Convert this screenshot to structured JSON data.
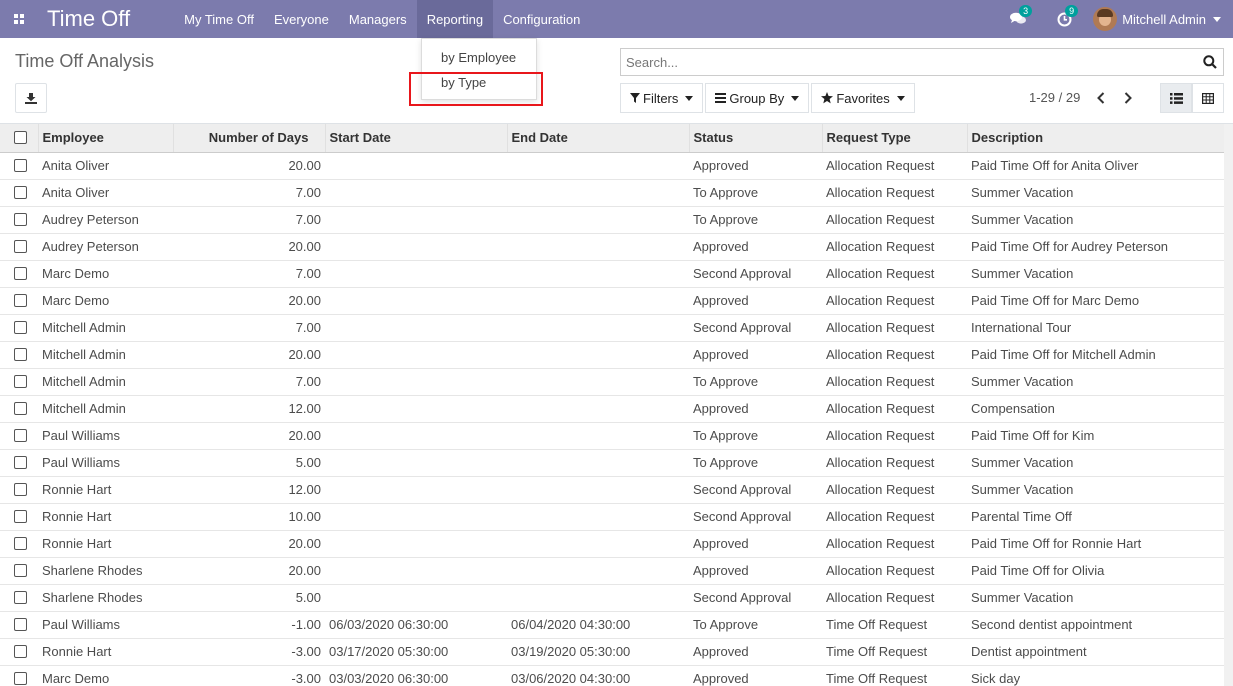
{
  "nav": {
    "brand": "Time Off",
    "menu": [
      "My Time Off",
      "Everyone",
      "Managers",
      "Reporting",
      "Configuration"
    ],
    "active_menu": "Reporting",
    "messages_count": "3",
    "activities_count": "9",
    "user_name": "Mitchell Admin"
  },
  "reporting_menu": {
    "items": [
      "by Employee",
      "by Type"
    ],
    "highlighted": "by Type"
  },
  "control_panel": {
    "title": "Time Off Analysis",
    "search_placeholder": "Search...",
    "filters_label": "Filters",
    "groupby_label": "Group By",
    "favorites_label": "Favorites",
    "pager": "1-29 / 29"
  },
  "table": {
    "columns": [
      "Employee",
      "Number of Days",
      "Start Date",
      "End Date",
      "Status",
      "Request Type",
      "Description"
    ],
    "rows": [
      [
        "Anita Oliver",
        "20.00",
        "",
        "",
        "Approved",
        "Allocation Request",
        "Paid Time Off for Anita Oliver"
      ],
      [
        "Anita Oliver",
        "7.00",
        "",
        "",
        "To Approve",
        "Allocation Request",
        "Summer Vacation"
      ],
      [
        "Audrey Peterson",
        "7.00",
        "",
        "",
        "To Approve",
        "Allocation Request",
        "Summer Vacation"
      ],
      [
        "Audrey Peterson",
        "20.00",
        "",
        "",
        "Approved",
        "Allocation Request",
        "Paid Time Off for Audrey Peterson"
      ],
      [
        "Marc Demo",
        "7.00",
        "",
        "",
        "Second Approval",
        "Allocation Request",
        "Summer Vacation"
      ],
      [
        "Marc Demo",
        "20.00",
        "",
        "",
        "Approved",
        "Allocation Request",
        "Paid Time Off for Marc Demo"
      ],
      [
        "Mitchell Admin",
        "7.00",
        "",
        "",
        "Second Approval",
        "Allocation Request",
        "International Tour"
      ],
      [
        "Mitchell Admin",
        "20.00",
        "",
        "",
        "Approved",
        "Allocation Request",
        "Paid Time Off for Mitchell Admin"
      ],
      [
        "Mitchell Admin",
        "7.00",
        "",
        "",
        "To Approve",
        "Allocation Request",
        "Summer Vacation"
      ],
      [
        "Mitchell Admin",
        "12.00",
        "",
        "",
        "Approved",
        "Allocation Request",
        "Compensation"
      ],
      [
        "Paul Williams",
        "20.00",
        "",
        "",
        "To Approve",
        "Allocation Request",
        "Paid Time Off for Kim"
      ],
      [
        "Paul Williams",
        "5.00",
        "",
        "",
        "To Approve",
        "Allocation Request",
        "Summer Vacation"
      ],
      [
        "Ronnie Hart",
        "12.00",
        "",
        "",
        "Second Approval",
        "Allocation Request",
        "Summer Vacation"
      ],
      [
        "Ronnie Hart",
        "10.00",
        "",
        "",
        "Second Approval",
        "Allocation Request",
        "Parental Time Off"
      ],
      [
        "Ronnie Hart",
        "20.00",
        "",
        "",
        "Approved",
        "Allocation Request",
        "Paid Time Off for Ronnie Hart"
      ],
      [
        "Sharlene Rhodes",
        "20.00",
        "",
        "",
        "Approved",
        "Allocation Request",
        "Paid Time Off for Olivia"
      ],
      [
        "Sharlene Rhodes",
        "5.00",
        "",
        "",
        "Second Approval",
        "Allocation Request",
        "Summer Vacation"
      ],
      [
        "Paul Williams",
        "-1.00",
        "06/03/2020 06:30:00",
        "06/04/2020 04:30:00",
        "To Approve",
        "Time Off Request",
        "Second dentist appointment"
      ],
      [
        "Ronnie Hart",
        "-3.00",
        "03/17/2020 05:30:00",
        "03/19/2020 05:30:00",
        "Approved",
        "Time Off Request",
        "Dentist appointment"
      ],
      [
        "Marc Demo",
        "-3.00",
        "03/03/2020 06:30:00",
        "03/06/2020 04:30:00",
        "Approved",
        "Time Off Request",
        "Sick day"
      ]
    ]
  }
}
